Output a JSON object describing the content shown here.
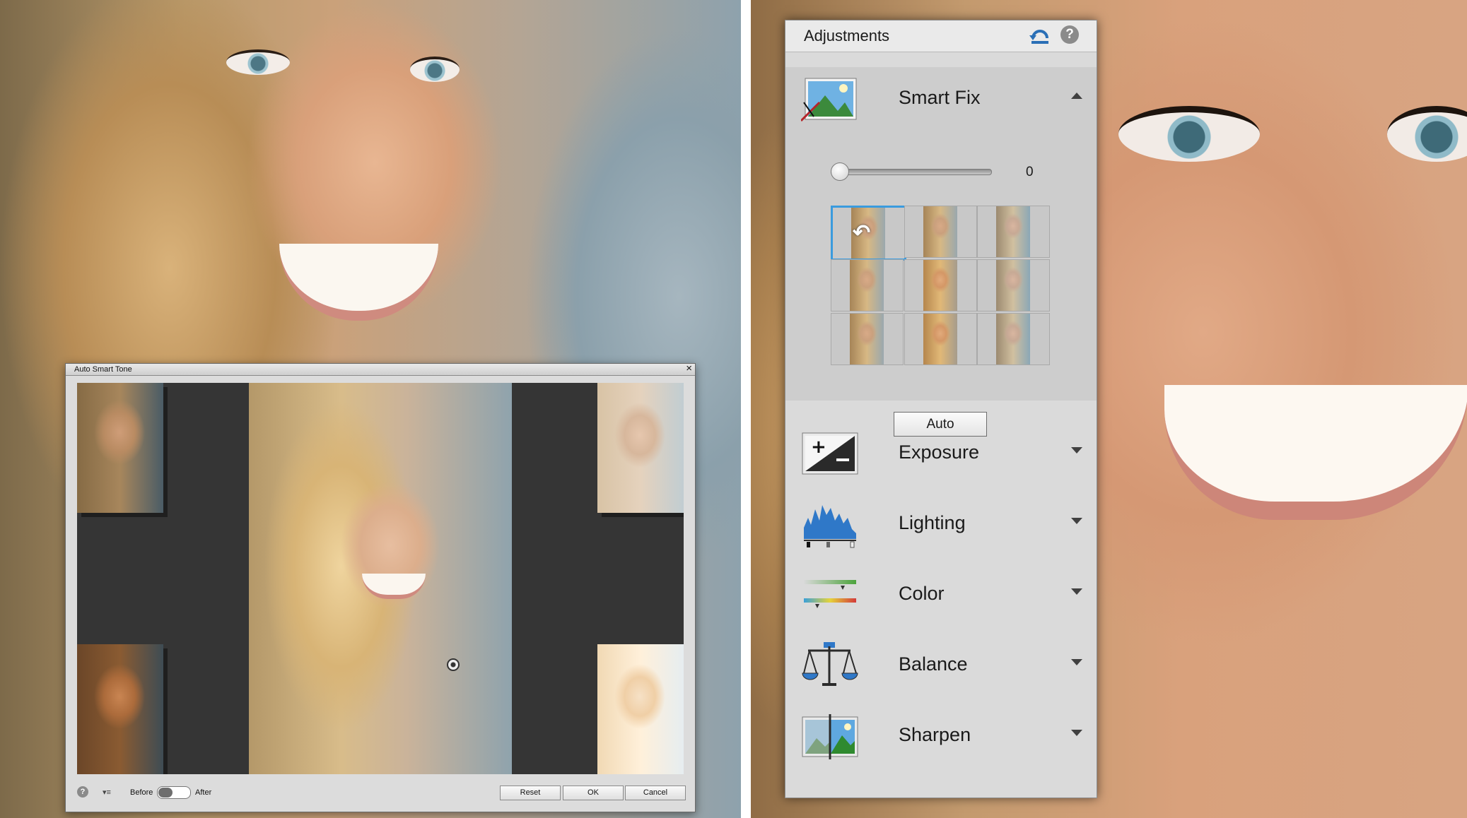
{
  "dialog": {
    "title": "Auto Smart Tone",
    "close_glyph": "×",
    "help_glyph": "?",
    "view_menu_glyph": "▾≡",
    "before_label": "Before",
    "after_label": "After",
    "buttons": {
      "reset": "Reset",
      "ok": "OK",
      "cancel": "Cancel"
    }
  },
  "panel": {
    "title": "Adjustments",
    "help_glyph": "?",
    "smart_fix": {
      "label": "Smart Fix",
      "slider_value": "0",
      "slider_fraction": 0,
      "auto_button": "Auto",
      "undo_glyph": "↶"
    },
    "sections": [
      {
        "label": "Exposure",
        "icon": "exposure-icon"
      },
      {
        "label": "Lighting",
        "icon": "histogram-icon"
      },
      {
        "label": "Color",
        "icon": "color-sliders-icon"
      },
      {
        "label": "Balance",
        "icon": "scales-icon"
      },
      {
        "label": "Sharpen",
        "icon": "sharpen-icon"
      }
    ]
  },
  "colors": {
    "selection": "#3a9bde",
    "reset_icon": "#2a6fb6",
    "panel_bg": "#dadada"
  }
}
